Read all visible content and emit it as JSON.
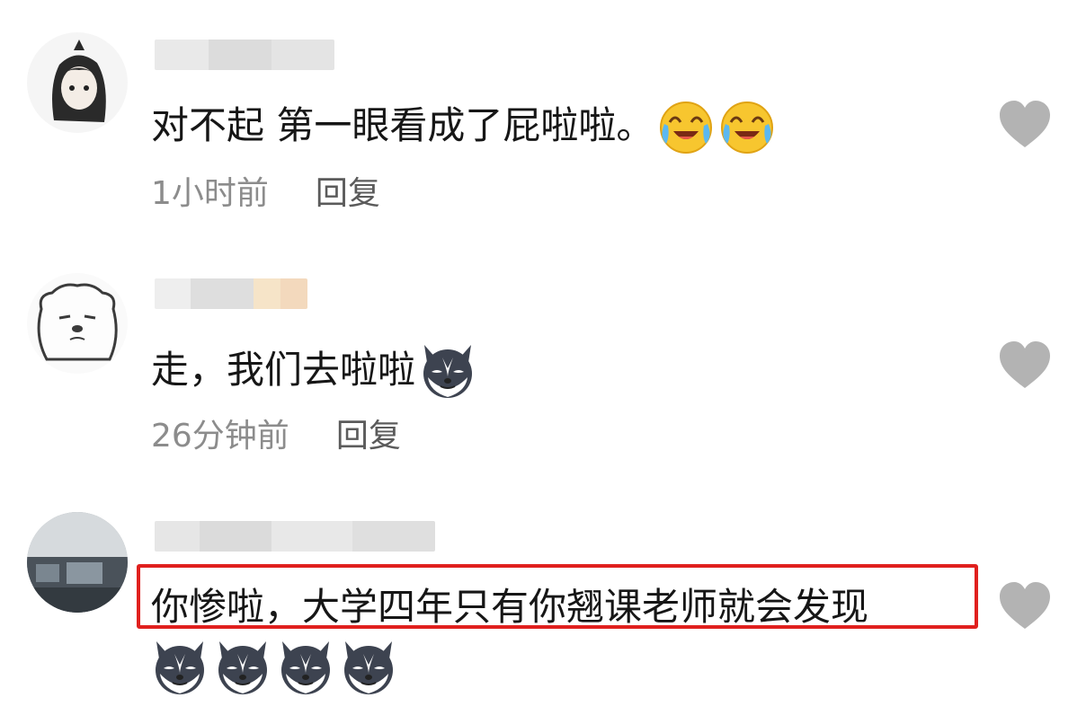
{
  "comments": [
    {
      "text": "对不起 第一眼看成了屁啦啦。",
      "time": "1小时前",
      "reply": "回复",
      "emojis": [
        "laugh-cry-emoji",
        "laugh-cry-emoji"
      ]
    },
    {
      "text": "走，我们去啦啦",
      "time": "26分钟前",
      "reply": "回复",
      "emojis": [
        "husky-emoji"
      ]
    },
    {
      "text": "你惨啦，大学四年只有你翘课老师就会发现",
      "emojis": [
        "husky-emoji",
        "husky-emoji",
        "husky-emoji",
        "husky-emoji"
      ],
      "highlighted": true
    }
  ],
  "colors": {
    "highlight_border": "#e0201e",
    "like_icon": "#b3b3b3",
    "meta_text": "#8c8c8c"
  },
  "icons": [
    "heart-like-icon"
  ]
}
